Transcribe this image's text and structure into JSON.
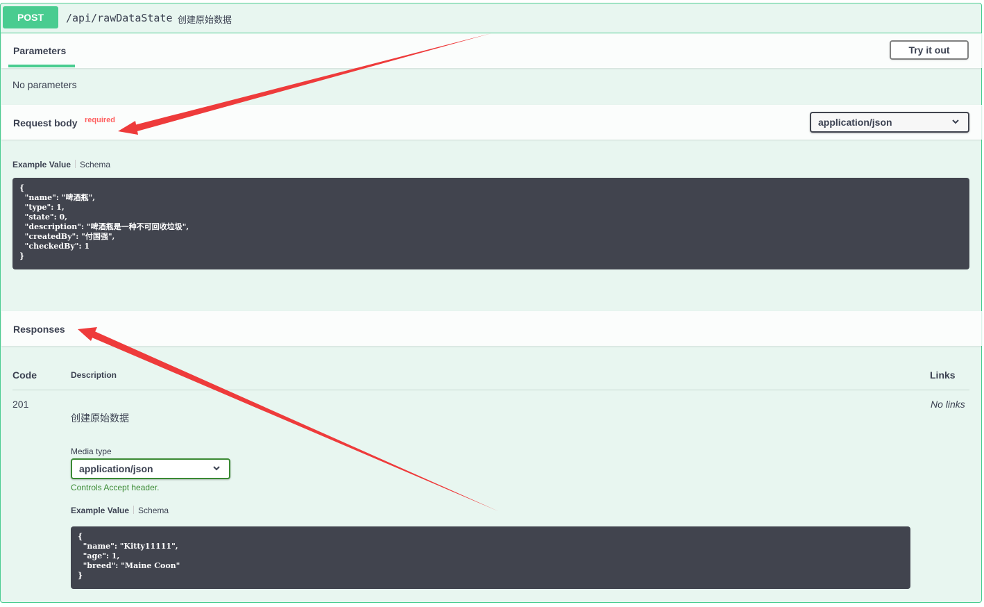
{
  "operation": {
    "method": "POST",
    "path": "/api/rawDataState",
    "summary": "创建原始数据"
  },
  "parameters": {
    "tab_label": "Parameters",
    "try_button": "Try it out",
    "empty_text": "No parameters"
  },
  "request_body": {
    "title": "Request body",
    "required_label": "required",
    "content_type": "application/json",
    "example_tab": "Example Value",
    "schema_tab": "Schema",
    "example_json": "{\n  \"name\": \"啤酒瓶\",\n  \"type\": 1,\n  \"state\": 0,\n  \"description\": \"啤酒瓶是一种不可回收垃圾\",\n  \"createdBy\": \"付国强\",\n  \"checkedBy\": 1\n}"
  },
  "responses": {
    "title": "Responses",
    "headers": {
      "code": "Code",
      "description": "Description",
      "links": "Links"
    },
    "rows": [
      {
        "code": "201",
        "description": "创建原始数据",
        "links": "No links",
        "media_type_label": "Media type",
        "media_type": "application/json",
        "controls_hint": "Controls Accept header.",
        "example_tab": "Example Value",
        "schema_tab": "Schema",
        "example_json": "{\n  \"name\": \"Kitty11111\",\n  \"age\": 1,\n  \"breed\": \"Maine Coon\"\n}"
      }
    ]
  },
  "colors": {
    "post_green": "#49cc90",
    "block_bg": "#e8f6f0",
    "code_bg": "#41444e",
    "required_red": "#ff6060",
    "annotation_arrow": "#ee3b3b"
  }
}
